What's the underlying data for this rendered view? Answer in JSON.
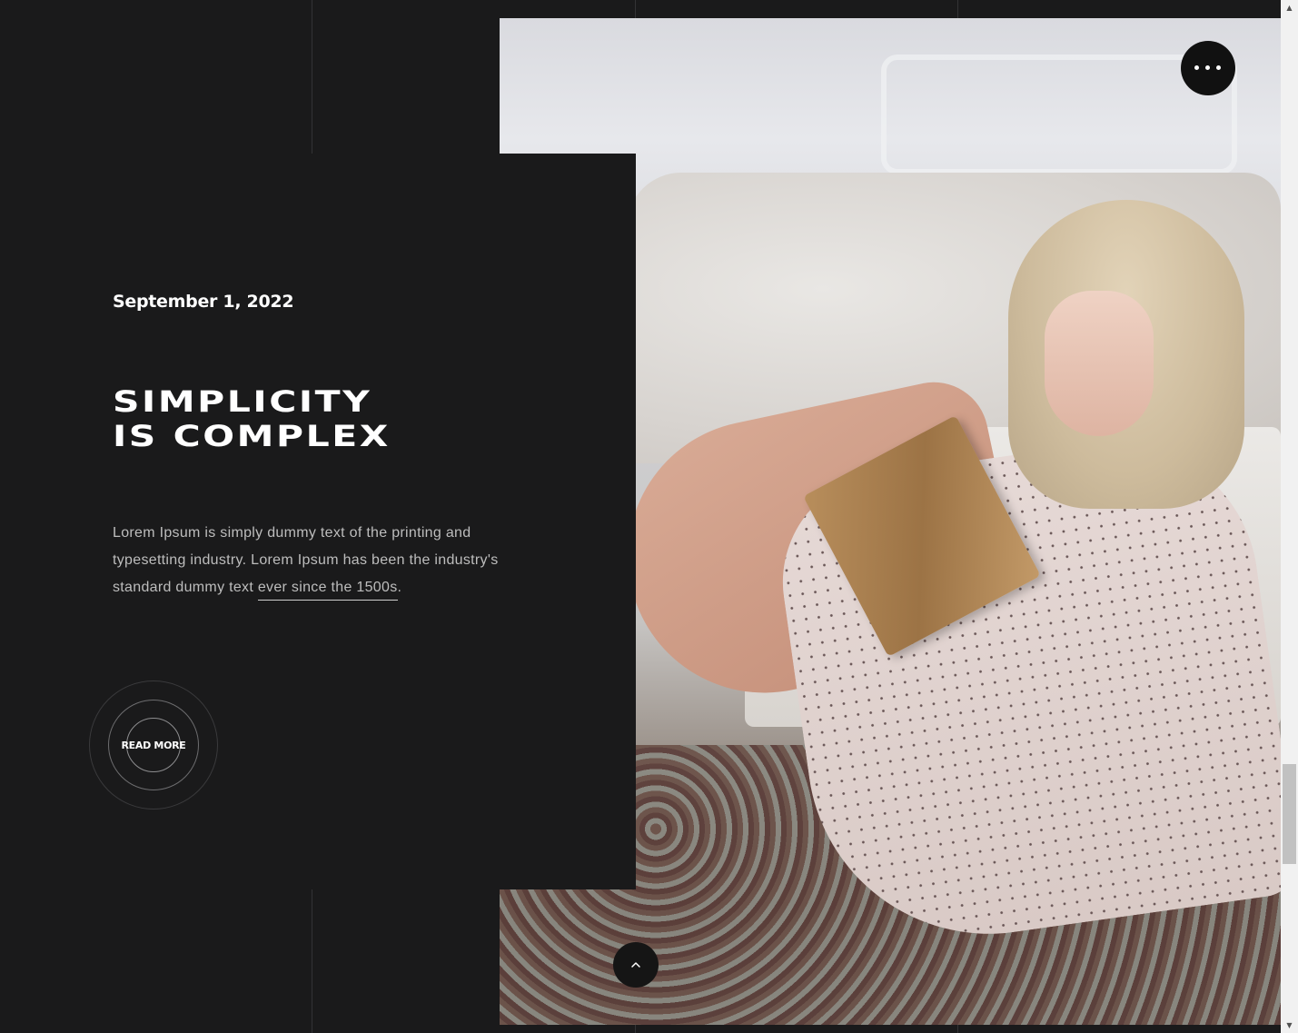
{
  "post": {
    "date": "September 1, 2022",
    "title_line1": "SIMPLICITY",
    "title_line2": "IS COMPLEX",
    "description_text": "Lorem Ipsum is simply dummy text of the printing and typesetting industry. Lorem Ipsum has been the industry's standard dummy text ",
    "description_link": "ever since the 1500s",
    "description_end": ".",
    "read_more_label": "READ MORE"
  },
  "photo": {
    "alt": "woman reading book on floor by sofa"
  },
  "controls": {
    "menu_icon": "more-dots-icon",
    "scroll_top_icon": "chevron-up-icon"
  },
  "scrollbar": {
    "up_arrow": "▲",
    "down_arrow": "▼"
  },
  "colors": {
    "background": "#1a1a1b",
    "text_primary": "#ffffff",
    "text_secondary": "#bdbdbd",
    "button_dark": "#111111"
  }
}
